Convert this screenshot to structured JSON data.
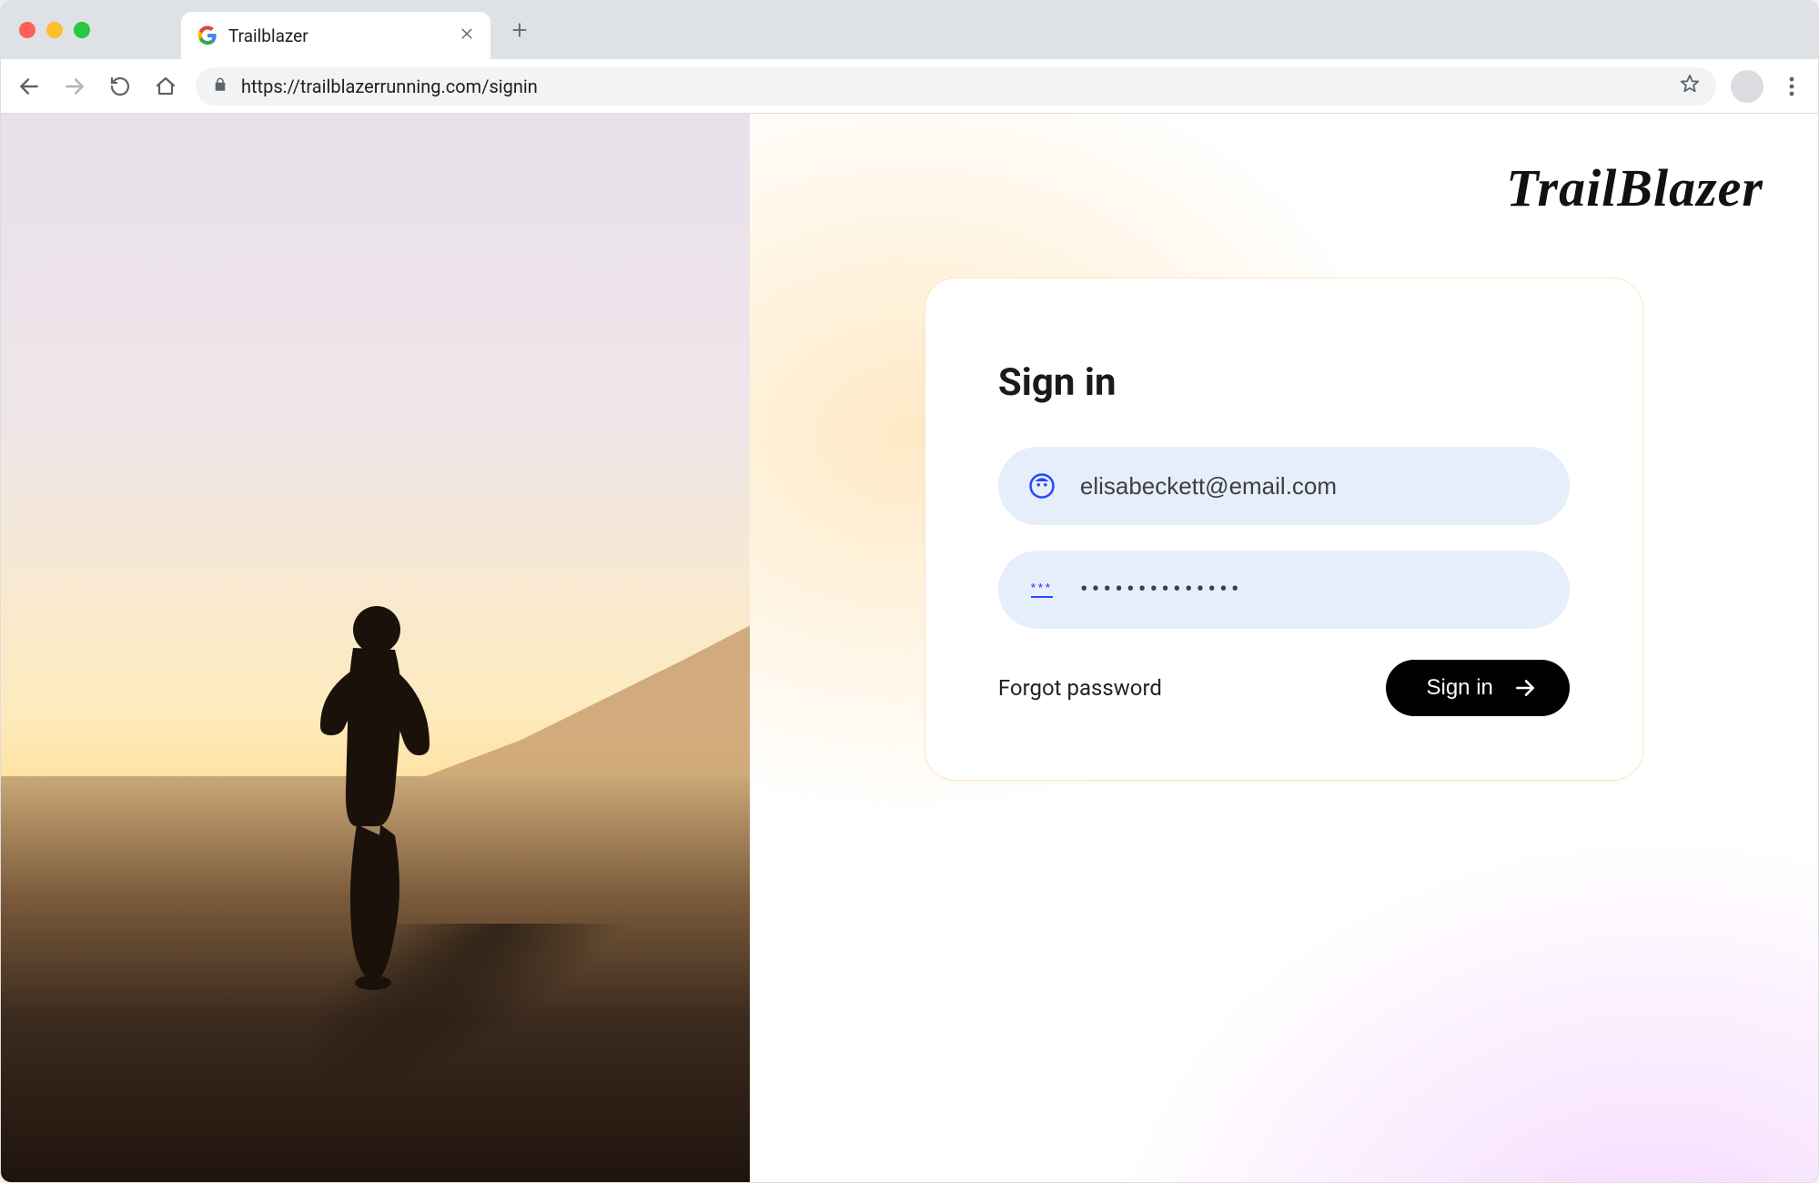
{
  "browser": {
    "tab_title": "Trailblazer",
    "url": "https://trailblazerrunning.com/signin"
  },
  "page": {
    "brand": "TrailBlazer",
    "card": {
      "title": "Sign in",
      "email_value": "elisabeckett@email.com",
      "password_masked": "••••••••••••••",
      "forgot_label": "Forgot password",
      "submit_label": "Sign in"
    }
  }
}
